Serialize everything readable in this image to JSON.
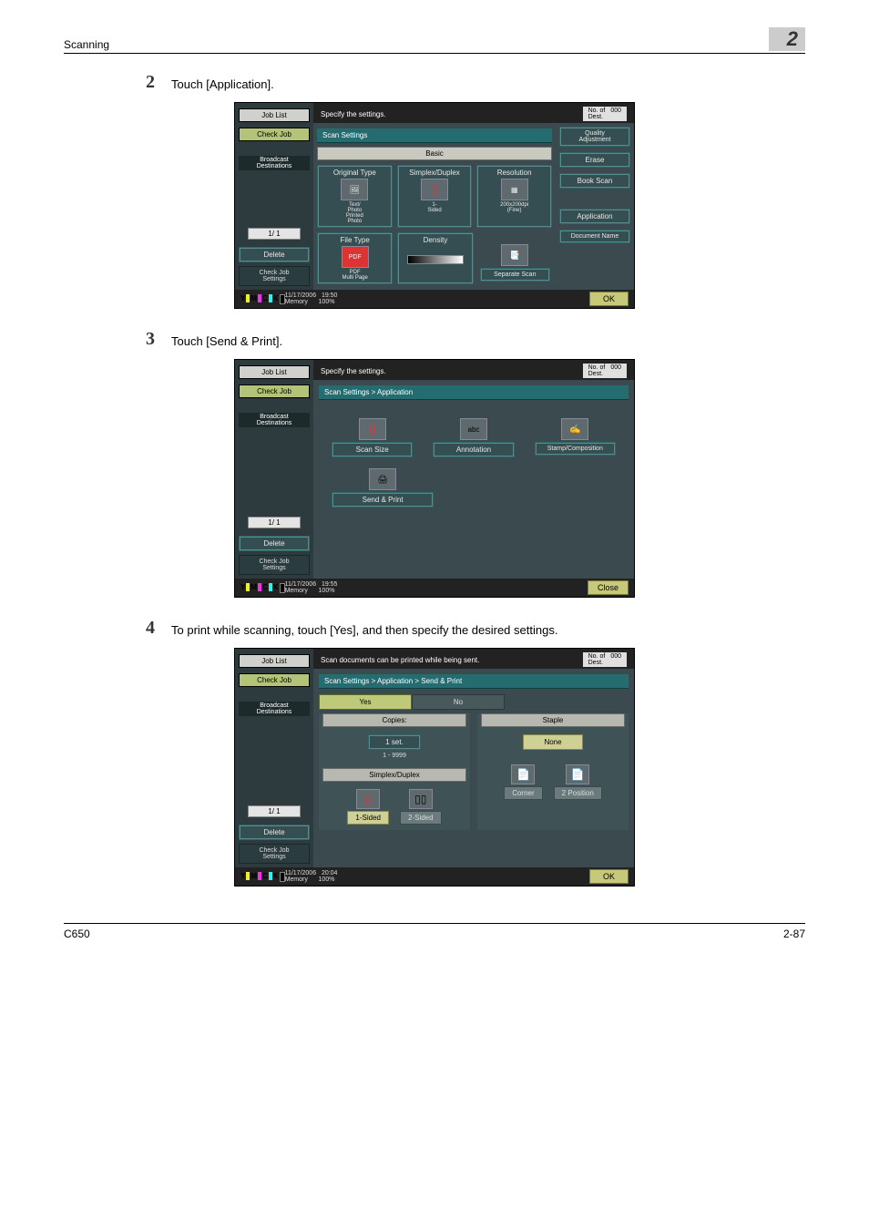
{
  "page": {
    "header_left": "Scanning",
    "header_right": "2",
    "footer_left": "C650",
    "footer_right": "2-87"
  },
  "steps": [
    {
      "n": "2",
      "text": "Touch [Application]."
    },
    {
      "n": "3",
      "text": "Touch [Send & Print]."
    },
    {
      "n": "4",
      "text": "To print while scanning, touch [Yes], and then specify the desired settings."
    }
  ],
  "common_sidebar": {
    "job_list": "Job List",
    "check_job": "Check Job",
    "broadcast": "Broadcast\nDestinations",
    "pager": "1/  1",
    "delete": "Delete",
    "check_job_settings": "Check Job\nSettings"
  },
  "toner": {
    "y": "Y",
    "m": "M",
    "c": "C",
    "k": "K"
  },
  "common_footer": {
    "memory": "Memory",
    "pct": "100%"
  },
  "shot1": {
    "title": "Specify the settings.",
    "no_of_label": "No. of\nDest.",
    "no_of_val": "000",
    "crumb": "Scan Settings",
    "tab": "Basic",
    "opt1": "Original Type",
    "opt1v": "Text/\nPhoto\nPrinted\nPhoto",
    "opt2": "Simplex/Duplex",
    "opt2v": "1-\nSided",
    "opt3": "Resolution",
    "opt3v": "200x200dpi\n(Fine)",
    "opt4": "File Type",
    "opt4b": "PDF",
    "opt4v": "PDF\nMulti Page",
    "opt5": "Density",
    "opt6": "Separate Scan",
    "r1": "Quality\nAdjustment",
    "r2": "Erase",
    "r3": "Book Scan",
    "r4": "Application",
    "r5": "Document Name",
    "date": "11/17/2006",
    "time": "19:50",
    "ok": "OK"
  },
  "shot2": {
    "title": "Specify the settings.",
    "no_of_label": "No. of\nDest.",
    "no_of_val": "000",
    "crumb": "Scan Settings > Application",
    "b1": "Scan Size",
    "b2": "Annotation",
    "b3": "Stamp/Composition",
    "b4": "Send & Print",
    "date": "11/17/2006",
    "time": "19:55",
    "close": "Close"
  },
  "shot3": {
    "title": "Scan documents can be printed while being sent.",
    "no_of_label": "No. of\nDest.",
    "no_of_val": "000",
    "crumb": "Scan Settings > Application > Send & Print",
    "yes": "Yes",
    "no": "No",
    "copies": "Copies:",
    "sets": "1 set.",
    "range": "1   -   9999",
    "simplex": "Simplex/Duplex",
    "sd1": "1-Sided",
    "sd2": "2-Sided",
    "staple": "Staple",
    "none": "None",
    "corner": "Corner",
    "pos2": "2 Position",
    "date": "11/17/2006",
    "time": "20:04",
    "ok": "OK"
  }
}
